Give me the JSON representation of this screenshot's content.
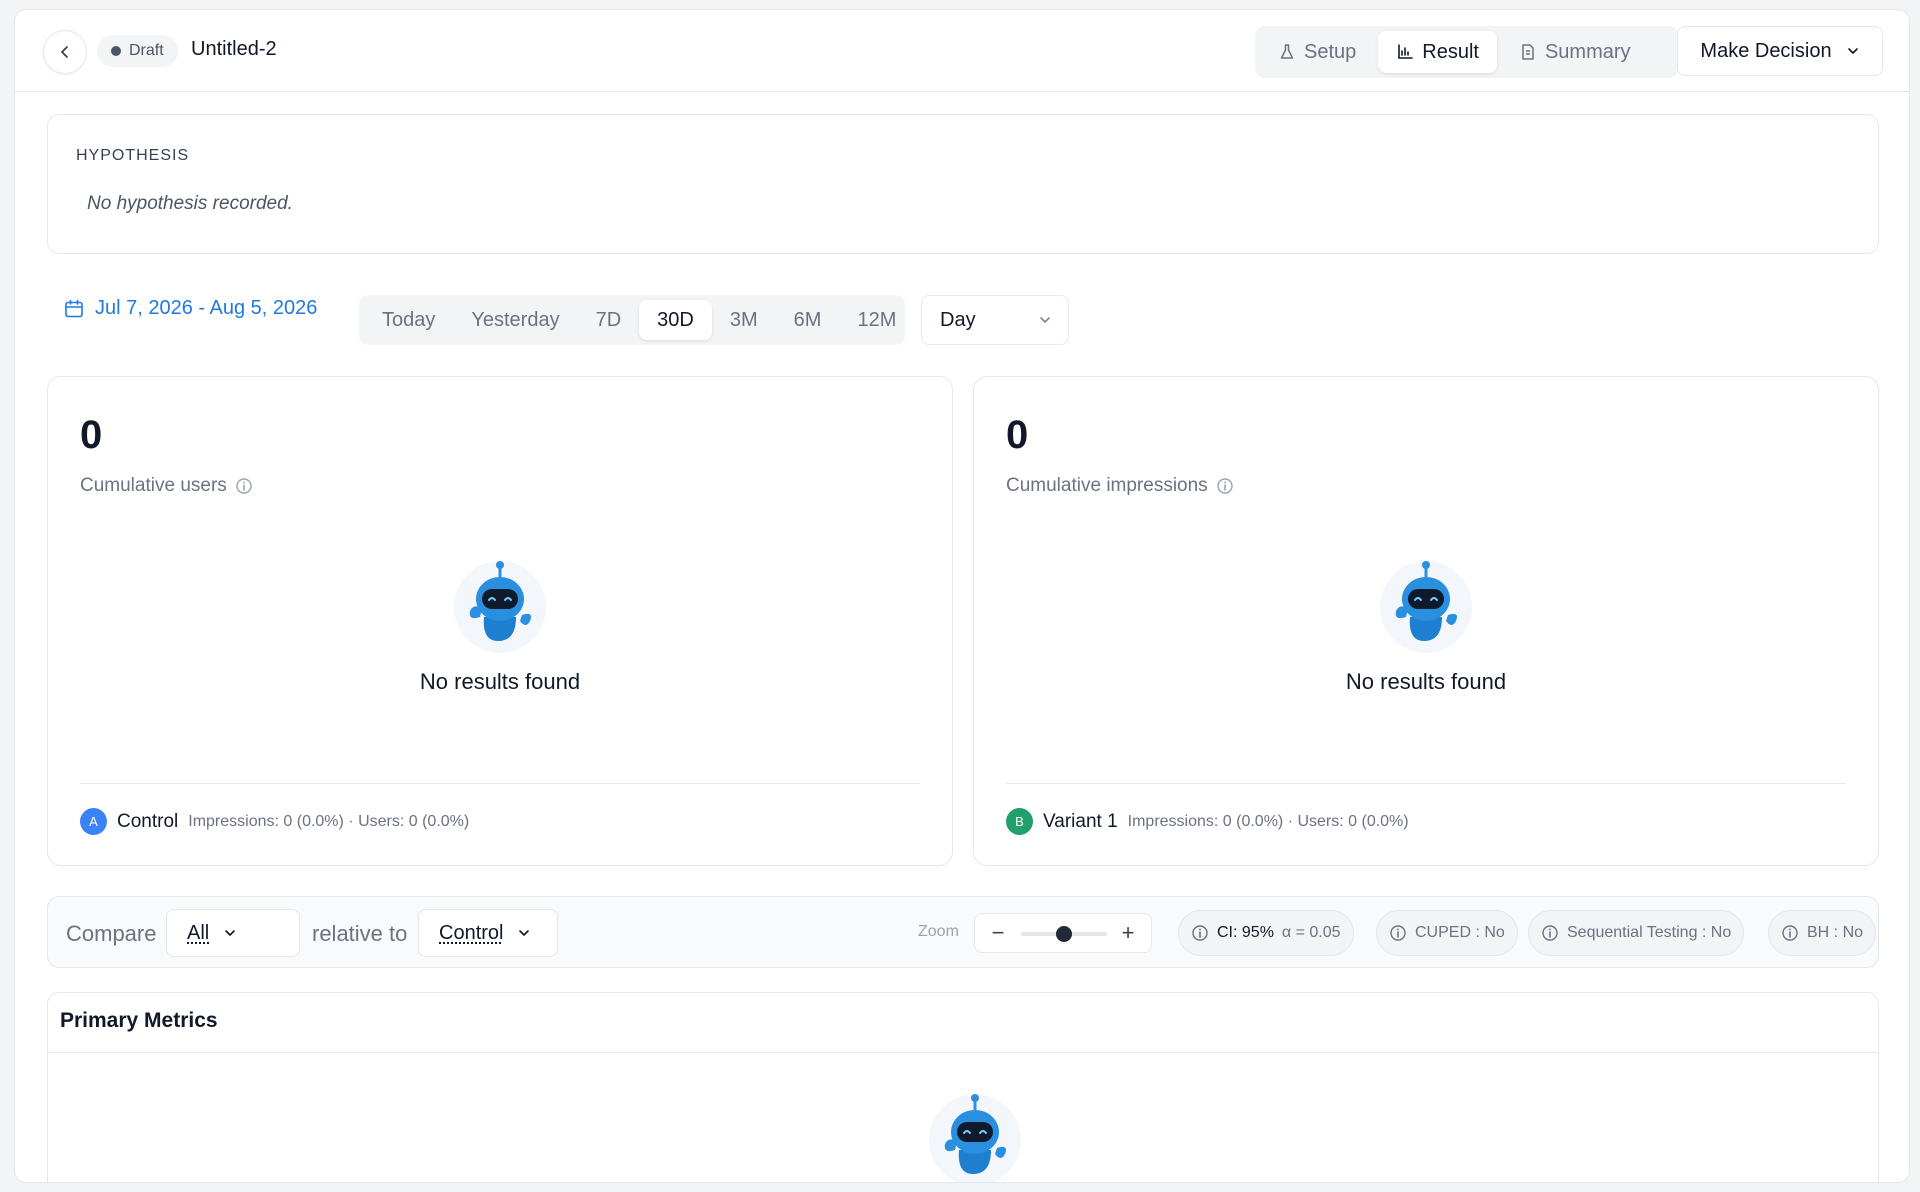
{
  "header": {
    "status": "Draft",
    "title": "Untitled-2",
    "tabs": [
      {
        "label": "Setup",
        "icon": "flask-icon"
      },
      {
        "label": "Result",
        "icon": "bar-chart-icon"
      },
      {
        "label": "Summary",
        "icon": "document-icon"
      }
    ],
    "active_tab": "Result",
    "decision_label": "Make Decision"
  },
  "hypothesis": {
    "label": "HYPOTHESIS",
    "text": "No hypothesis recorded."
  },
  "filters": {
    "date_range": "Jul 7, 2026 - Aug 5, 2026",
    "ranges": [
      "Today",
      "Yesterday",
      "7D",
      "30D",
      "3M",
      "6M",
      "12M"
    ],
    "active_range": "30D",
    "granularity": "Day"
  },
  "cards": [
    {
      "value": "0",
      "label": "Cumulative users",
      "empty_text": "No results found",
      "variant_letter": "A",
      "variant_name": "Control",
      "variant_color": "#3b82f6",
      "variant_stats": "Impressions: 0 (0.0%) · Users: 0 (0.0%)"
    },
    {
      "value": "0",
      "label": "Cumulative impressions",
      "empty_text": "No results found",
      "variant_letter": "B",
      "variant_name": "Variant 1",
      "variant_color": "#22a06b",
      "variant_stats": "Impressions: 0 (0.0%) · Users: 0 (0.0%)"
    }
  ],
  "compare": {
    "compare_label": "Compare",
    "compare_value": "All",
    "relative_label": "relative to",
    "relative_value": "Control",
    "zoom_label": "Zoom",
    "zoom_level": 0.5,
    "ci_label": "CI: 95%",
    "alpha_label": "α = 0.05",
    "cuped_label": "CUPED : No",
    "sequential_label": "Sequential Testing : No",
    "bh_label": "BH : No"
  },
  "metrics": {
    "title": "Primary Metrics"
  },
  "colors": {
    "accent": "#1f7ae0",
    "mascot": "#2b8fe0"
  }
}
